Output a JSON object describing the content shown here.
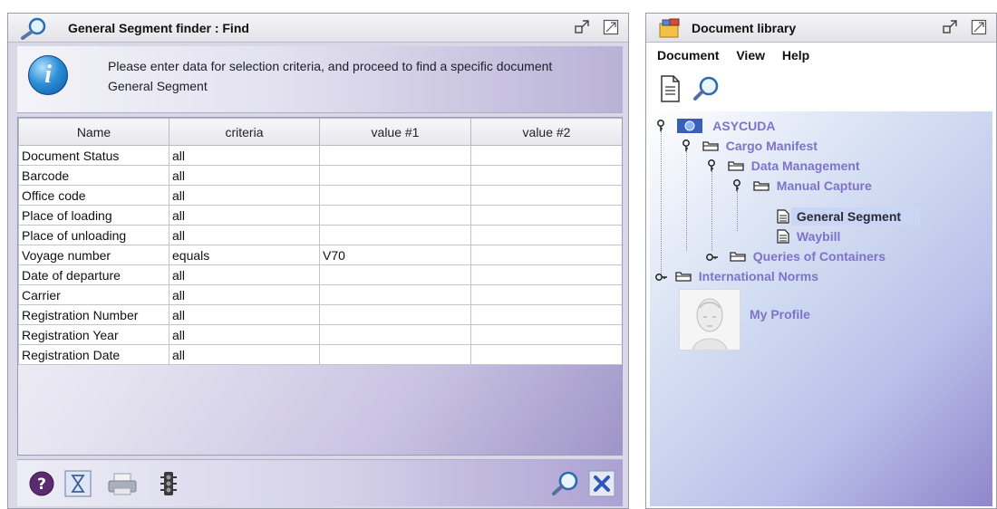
{
  "finder": {
    "title": "General Segment finder : Find",
    "info_text": "Please enter data for selection criteria, and proceed to find a specific document General Segment",
    "columns": [
      "Name",
      "criteria",
      "value #1",
      "value #2"
    ],
    "rows": [
      {
        "name": "Document Status",
        "criteria": "all",
        "value1": "",
        "value2": ""
      },
      {
        "name": "Barcode",
        "criteria": "all",
        "value1": "",
        "value2": ""
      },
      {
        "name": "Office code",
        "criteria": "all",
        "value1": "",
        "value2": ""
      },
      {
        "name": "Place of loading",
        "criteria": "all",
        "value1": "",
        "value2": ""
      },
      {
        "name": "Place of unloading",
        "criteria": "all",
        "value1": "",
        "value2": ""
      },
      {
        "name": "Voyage number",
        "criteria": "equals",
        "value1": "V70",
        "value2": ""
      },
      {
        "name": "Date of departure",
        "criteria": "all",
        "value1": "",
        "value2": ""
      },
      {
        "name": "Carrier",
        "criteria": "all",
        "value1": "",
        "value2": ""
      },
      {
        "name": "Registration Number",
        "criteria": "all",
        "value1": "",
        "value2": ""
      },
      {
        "name": "Registration Year",
        "criteria": "all",
        "value1": "",
        "value2": ""
      },
      {
        "name": "Registration Date",
        "criteria": "all",
        "value1": "",
        "value2": ""
      }
    ],
    "bottom_buttons": [
      "help-icon",
      "hourglass-icon",
      "print-icon",
      "traffic-light-icon",
      "find-icon",
      "close-icon"
    ]
  },
  "library": {
    "title": "Document library",
    "menu": [
      "Document",
      "View",
      "Help"
    ],
    "toolbar": [
      "new-document-icon",
      "search-icon"
    ],
    "tree": {
      "root": "ASYCUDA",
      "cargo_manifest": "Cargo Manifest",
      "data_management": "Data Management",
      "manual_capture": "Manual Capture",
      "general_segment": "General Segment",
      "waybill": "Waybill",
      "queries_of_containers": "Queries of Containers",
      "international_norms": "International Norms",
      "my_profile": "My Profile"
    }
  },
  "colors": {
    "accent_purple": "#7d73c9",
    "title_bar": "#e6e6ec",
    "selection": "#c9d6f6"
  }
}
